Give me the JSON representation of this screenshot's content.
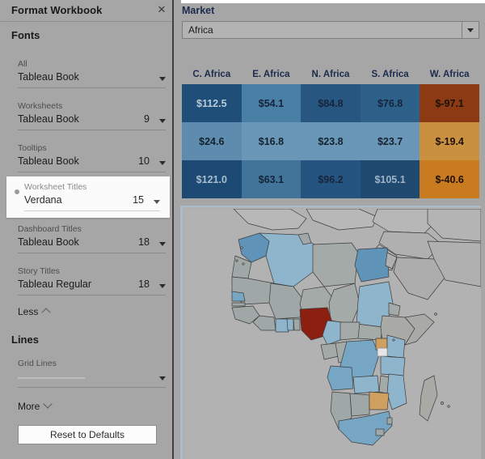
{
  "panel": {
    "title": "Format Workbook",
    "close_icon": "close-icon",
    "sections": {
      "fonts": "Fonts",
      "lines": "Lines"
    },
    "font_fields": [
      {
        "label": "All",
        "value": "Tableau Book",
        "size": ""
      },
      {
        "label": "Worksheets",
        "value": "Tableau Book",
        "size": "9"
      },
      {
        "label": "Tooltips",
        "value": "Tableau Book",
        "size": "10"
      },
      {
        "label": "Worksheet Titles",
        "value": "Verdana",
        "size": "15"
      },
      {
        "label": "Dashboard Titles",
        "value": "Tableau Book",
        "size": "18"
      },
      {
        "label": "Story Titles",
        "value": "Tableau Regular",
        "size": "18"
      }
    ],
    "selected_field_index": 3,
    "less_link": "Less",
    "line_fields": [
      {
        "label": "Grid Lines",
        "value": ""
      }
    ],
    "more_link": "More",
    "reset_button": "Reset to Defaults"
  },
  "filter": {
    "label": "Market",
    "value": "Africa",
    "dropdown_icon": "chevron-down-icon"
  },
  "chart_data": {
    "type": "table",
    "title": "",
    "categories": [
      "C. Africa",
      "E. Africa",
      "N. Africa",
      "S. Africa",
      "W. Africa"
    ],
    "rows": [
      {
        "values": [
          "$112.5",
          "$54.1",
          "$84.8",
          "$76.8",
          "$-97.1"
        ],
        "numeric": [
          112.5,
          54.1,
          84.8,
          76.8,
          -97.1
        ],
        "bg": [
          "#1f4e79",
          "#4a7fa5",
          "#275680",
          "#2d6189",
          "#8b3a14"
        ],
        "fg": [
          "#b9cbd8",
          "#15233a",
          "#16253b",
          "#16253b",
          "#1d1008"
        ]
      },
      {
        "values": [
          "$24.6",
          "$16.8",
          "$23.8",
          "$23.7",
          "$-19.4"
        ],
        "numeric": [
          24.6,
          16.8,
          23.8,
          23.7,
          -19.4
        ],
        "bg": [
          "#5e8caf",
          "#6a96b8",
          "#6a96b8",
          "#6a96b8",
          "#c9913f"
        ],
        "fg": [
          "#14222f",
          "#14222f",
          "#14222f",
          "#14222f",
          "#1d1008"
        ]
      },
      {
        "values": [
          "$121.0",
          "$63.1",
          "$96.2",
          "$105.1",
          "$-40.6"
        ],
        "numeric": [
          121.0,
          63.1,
          96.2,
          105.1,
          -40.6
        ],
        "bg": [
          "#1c4a74",
          "#417499",
          "#255480",
          "#20496f",
          "#c97b20"
        ],
        "fg": [
          "#a9bdcc",
          "#15233a",
          "#16253b",
          "#9fb4c6",
          "#1d1008"
        ]
      }
    ],
    "colors": {
      "positive_dark": "#1f4e79",
      "positive_light": "#6a96b8",
      "negative_dark": "#8b3a14",
      "negative_light": "#c9913f"
    }
  },
  "map": {
    "name": "africa-choropleth-map",
    "background": "#b2b2b2",
    "colors": {
      "no_data": "#a9a9a5",
      "blue_light": "#8fb0c6",
      "blue_mid": "#7ba5c0",
      "blue_dark": "#4f88b0",
      "red": "#8b2010",
      "tan": "#d0a061"
    }
  }
}
